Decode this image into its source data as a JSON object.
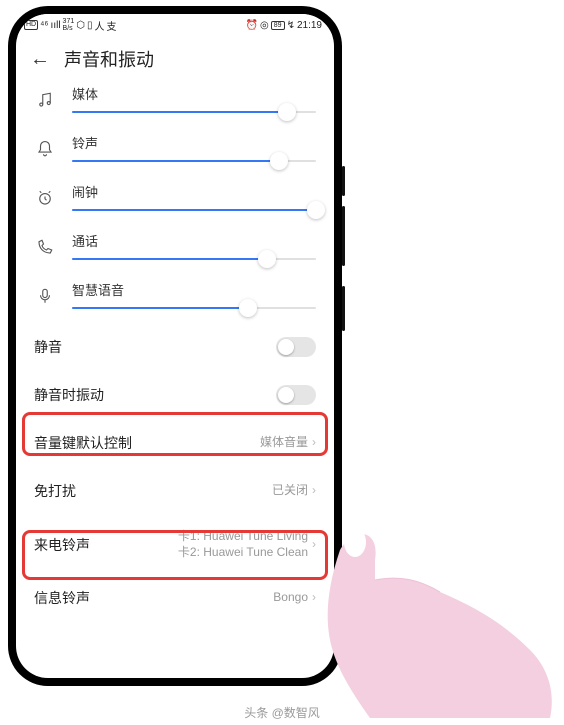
{
  "status": {
    "hd": "HD",
    "signal": "ııll",
    "net": "⁴⁶",
    "speed1": "371",
    "speed2": "B/s",
    "wifi": "⬡",
    "sim": "▯",
    "user": "人",
    "pay": "支",
    "alarm": "⏰",
    "eye": "◎",
    "batt_pct": "89",
    "time": "21:19"
  },
  "header": {
    "title": "声音和振动"
  },
  "sliders": [
    {
      "icon": "music",
      "label": "媒体",
      "pct": 88
    },
    {
      "icon": "bell",
      "label": "铃声",
      "pct": 85
    },
    {
      "icon": "alarm",
      "label": "闹钟",
      "pct": 100
    },
    {
      "icon": "call",
      "label": "通话",
      "pct": 80
    },
    {
      "icon": "mic",
      "label": "智慧语音",
      "pct": 72
    }
  ],
  "rows": {
    "mute": "静音",
    "vibrate_on_mute": "静音时振动",
    "vol_key": {
      "label": "音量键默认控制",
      "value": "媒体音量"
    },
    "dnd": {
      "label": "免打扰",
      "value": "已关闭"
    },
    "ringtone": {
      "label": "来电铃声",
      "line1": "卡1: Huawei Tune Living",
      "line2": "卡2: Huawei Tune Clean"
    },
    "sms": {
      "label": "信息铃声",
      "value": "Bongo"
    }
  },
  "footer": "头条 @数智风"
}
